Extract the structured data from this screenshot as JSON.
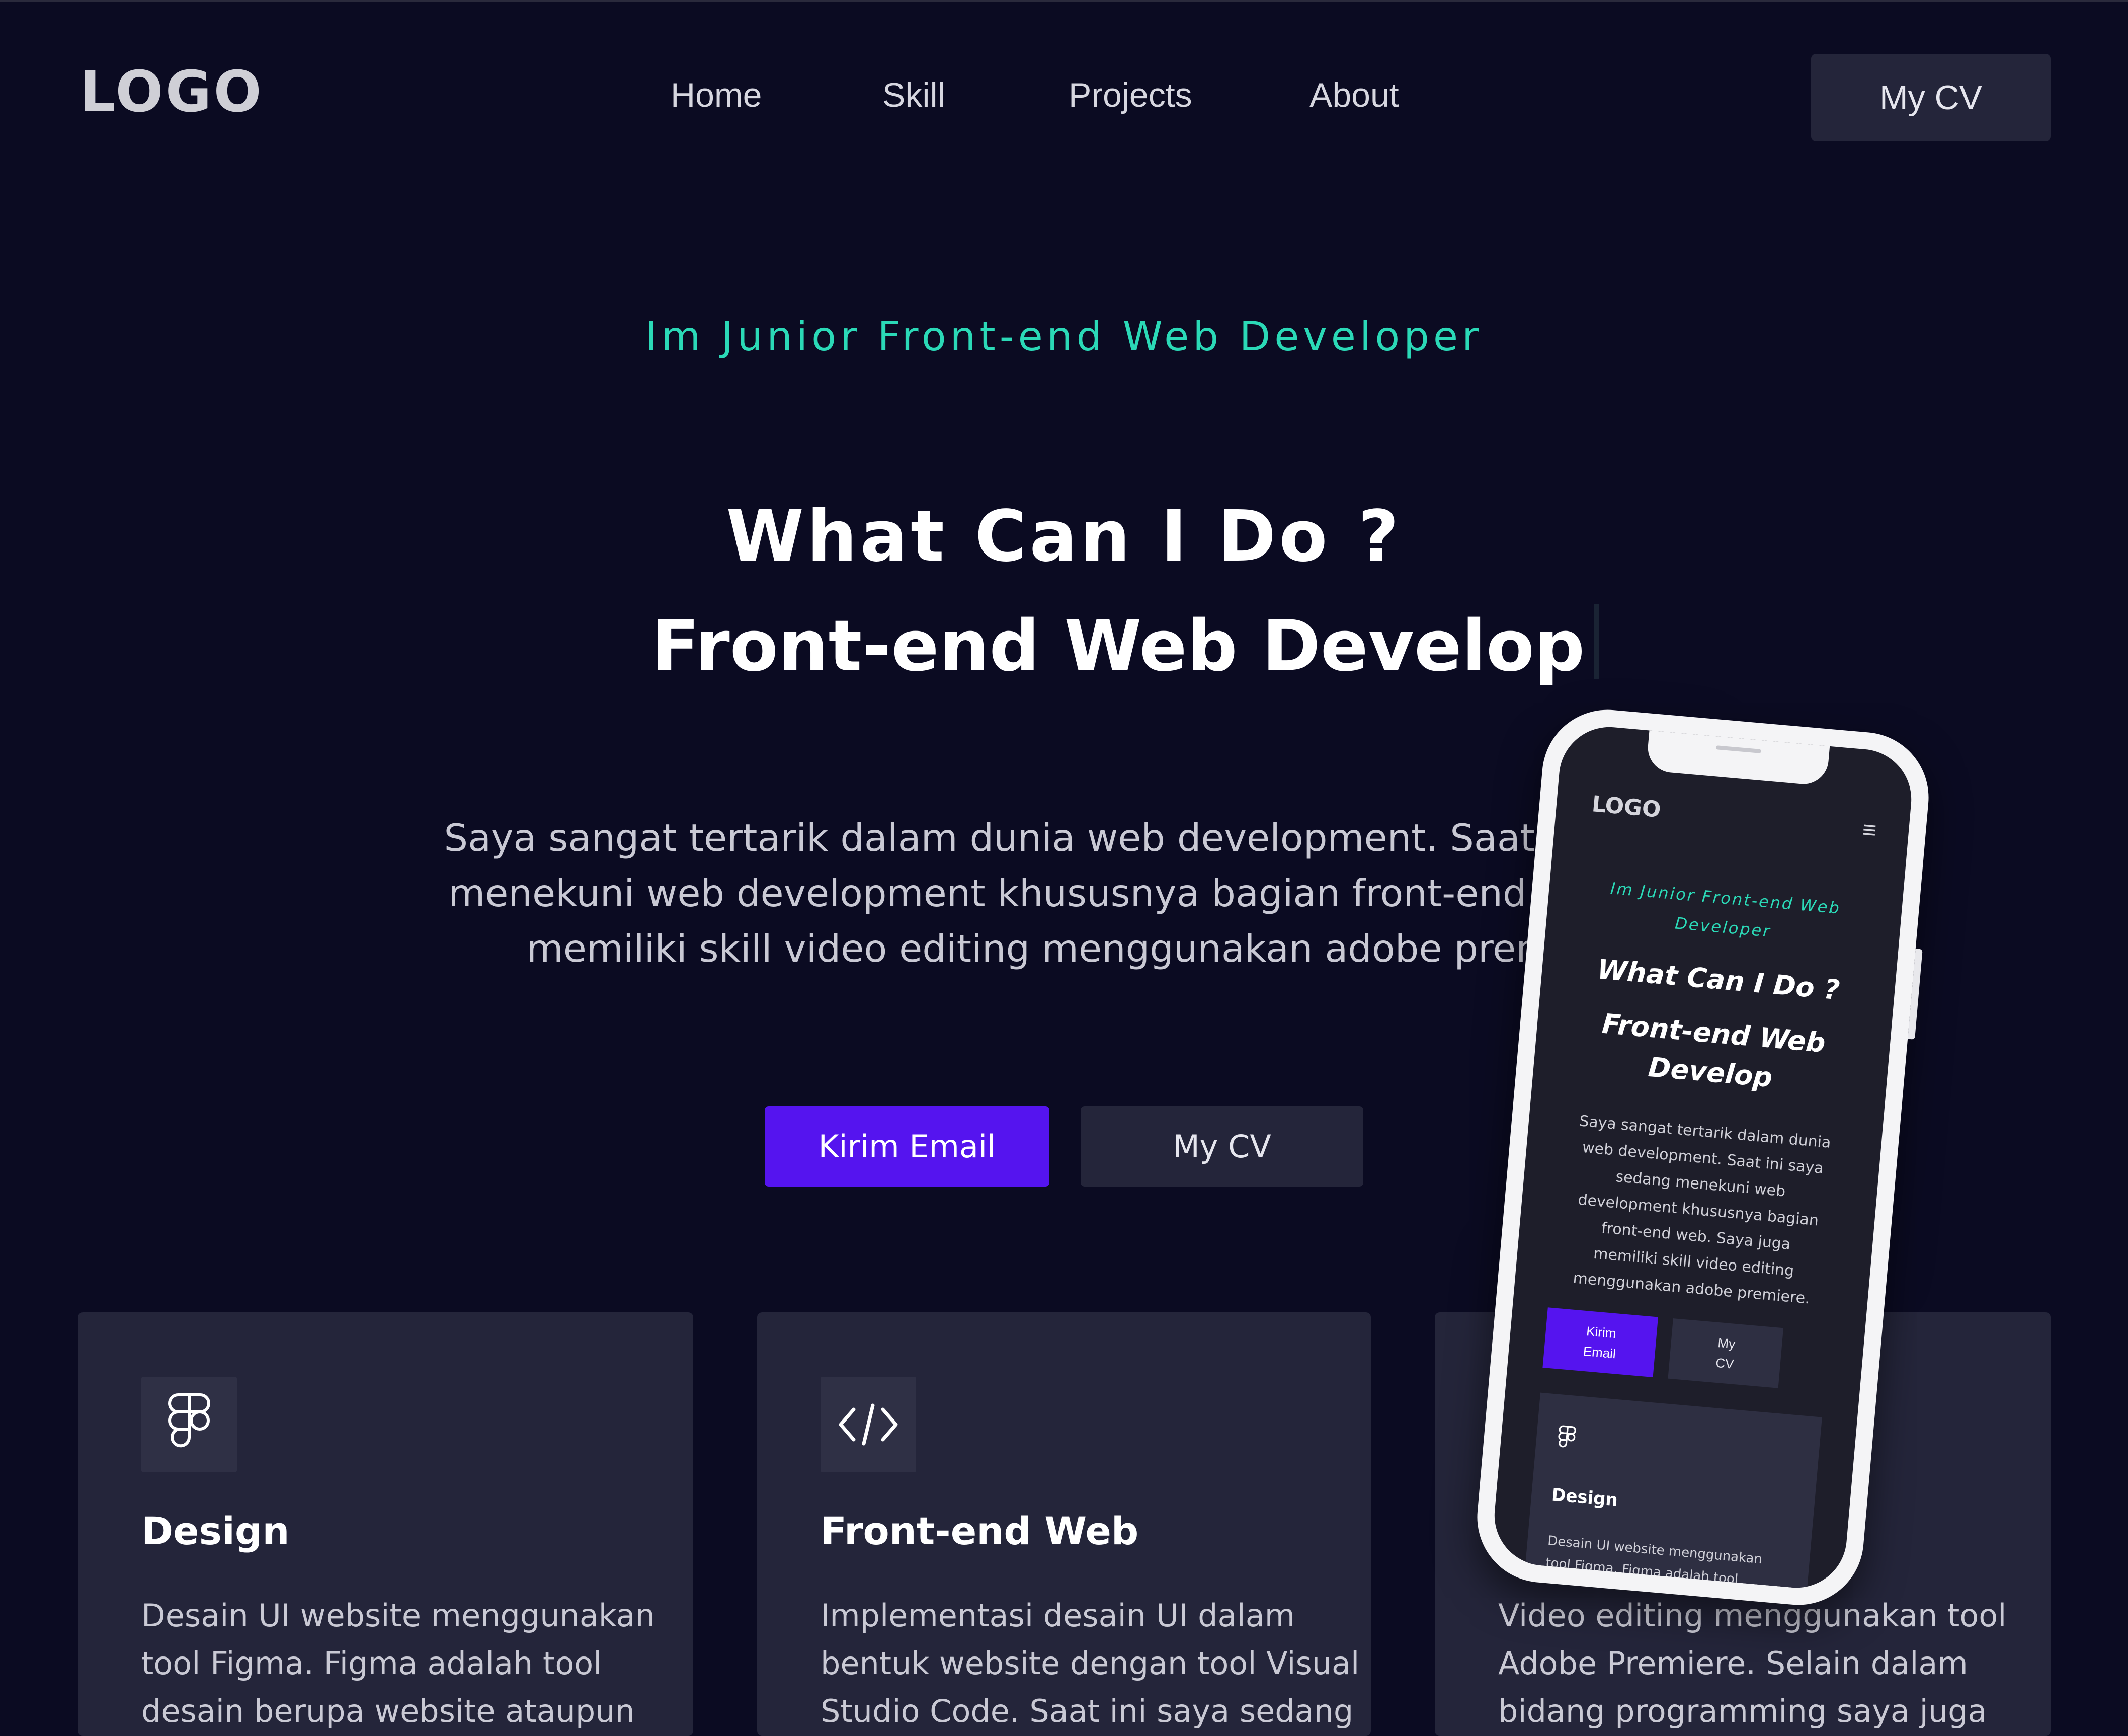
{
  "brand": {
    "logo": "LOGO"
  },
  "nav": {
    "items": [
      {
        "label": "Home"
      },
      {
        "label": "Skill"
      },
      {
        "label": "Projects"
      },
      {
        "label": "About"
      }
    ],
    "cv_button": "My CV"
  },
  "hero": {
    "subtitle": "Im Junior Front-end Web Developer",
    "heading": "What Can I Do ?",
    "typed_role": "Front-end Web Develop",
    "description_lines": [
      "Saya sangat tertarik dalam dunia web development. Saat ini say",
      "menekuni web development khususnya bagian front-end web. S",
      "memiliki skill video editing menggunakan adobe premie"
    ],
    "email_button": "Kirim Email",
    "cv_button": "My CV"
  },
  "cards": [
    {
      "icon": "figma-icon",
      "title": "Design",
      "lines": [
        "Desain UI website menggunakan",
        "tool Figma. Figma adalah tool",
        "desain berupa website ataupun"
      ]
    },
    {
      "icon": "code-icon",
      "title": "Front-end Web",
      "lines": [
        "Implementasi desain UI dalam",
        "bentuk website dengan tool Visual",
        "Studio Code. Saat ini saya sedang"
      ]
    },
    {
      "icon": "video-icon",
      "title": "",
      "lines": [
        "Video editing menggunakan tool",
        "Adobe Premiere. Selain dalam",
        "bidang programming saya juga"
      ]
    }
  ],
  "mobile_preview": {
    "logo": "LOGO",
    "menu_icon": "hamburger-icon",
    "subtitle_lines": [
      "Im Junior Front-end Web",
      "Developer"
    ],
    "heading": "What Can I Do ?",
    "role_lines": [
      "Front-end Web",
      "Develop"
    ],
    "description_lines": [
      "Saya sangat tertarik dalam dunia",
      "web development. Saat ini saya",
      "sedang menekuni web",
      "development khususnya bagian",
      "front-end web. Saya juga",
      "memiliki skill video editing",
      "menggunakan adobe premiere."
    ],
    "email_button_lines": [
      "Kirim",
      "Email"
    ],
    "cv_button_lines": [
      "My",
      "CV"
    ],
    "card_title": "Design",
    "card_lines": [
      "Desain UI website menggunakan",
      "tool Figma. Figma adalah tool"
    ]
  },
  "colors": {
    "background": "#0b0b22",
    "card": "#24253a",
    "accent_teal": "#2bd9b7",
    "accent_purple": "#5514ef"
  }
}
